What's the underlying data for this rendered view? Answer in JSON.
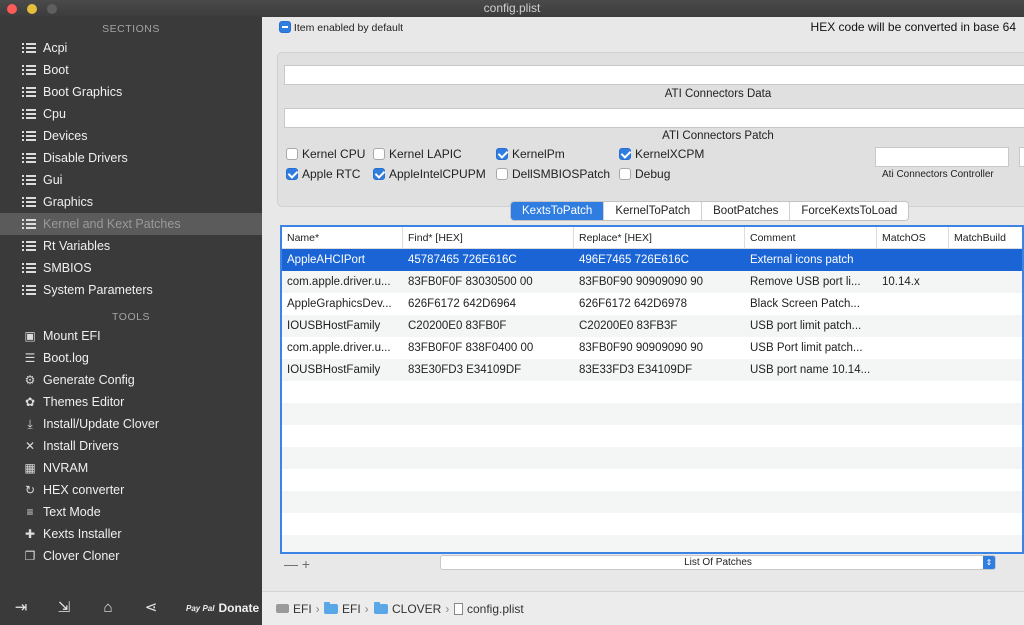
{
  "window": {
    "title": "config.plist"
  },
  "sidebar": {
    "sections_title": "SECTIONS",
    "sections": [
      {
        "label": "Acpi",
        "icon": "list-icon"
      },
      {
        "label": "Boot",
        "icon": "list-icon"
      },
      {
        "label": "Boot Graphics",
        "icon": "list-icon"
      },
      {
        "label": "Cpu",
        "icon": "list-icon"
      },
      {
        "label": "Devices",
        "icon": "list-icon"
      },
      {
        "label": "Disable Drivers",
        "icon": "list-icon"
      },
      {
        "label": "Gui",
        "icon": "list-icon"
      },
      {
        "label": "Graphics",
        "icon": "list-icon"
      },
      {
        "label": "Kernel and Kext Patches",
        "icon": "list-icon",
        "active": true
      },
      {
        "label": "Rt Variables",
        "icon": "list-icon"
      },
      {
        "label": "SMBIOS",
        "icon": "list-icon"
      },
      {
        "label": "System Parameters",
        "icon": "list-icon"
      }
    ],
    "tools_title": "TOOLS",
    "tools": [
      {
        "label": "Mount EFI",
        "icon": "disk-icon"
      },
      {
        "label": "Boot.log",
        "icon": "log-icon"
      },
      {
        "label": "Generate Config",
        "icon": "gears-icon"
      },
      {
        "label": "Themes Editor",
        "icon": "palette-icon"
      },
      {
        "label": "Install/Update Clover",
        "icon": "download-icon"
      },
      {
        "label": "Install Drivers",
        "icon": "tools-icon"
      },
      {
        "label": "NVRAM",
        "icon": "chip-icon"
      },
      {
        "label": "HEX converter",
        "icon": "refresh-icon"
      },
      {
        "label": "Text Mode",
        "icon": "text-icon"
      },
      {
        "label": "Kexts Installer",
        "icon": "puzzle-icon"
      },
      {
        "label": "Clover Cloner",
        "icon": "clone-icon"
      }
    ],
    "bottom": {
      "donate_label": "Donate",
      "paypal_label": "Pay Pal"
    }
  },
  "main": {
    "item_enabled_label": "Item enabled by default",
    "hex_note": "HEX code will be converted in base 64",
    "ati_connectors_data_label": "ATI Connectors Data",
    "ati_connectors_patch_label": "ATI Connectors Patch",
    "ati_connectors_controller_label": "Ati Connectors Controller",
    "options": [
      {
        "label": "Kernel CPU",
        "checked": false
      },
      {
        "label": "Kernel LAPIC",
        "checked": false
      },
      {
        "label": "KernelPm",
        "checked": true
      },
      {
        "label": "KernelXCPM",
        "checked": true
      },
      {
        "label": "Apple RTC",
        "checked": true
      },
      {
        "label": "AppleIntelCPUPM",
        "checked": true
      },
      {
        "label": "DellSMBIOSPatch",
        "checked": false
      },
      {
        "label": "Debug",
        "checked": false
      }
    ],
    "tabs": [
      "KextsToPatch",
      "KernelToPatch",
      "BootPatches",
      "ForceKextsToLoad"
    ],
    "active_tab": "KextsToPatch",
    "table": {
      "columns": [
        "Name*",
        "Find* [HEX]",
        "Replace* [HEX]",
        "Comment",
        "MatchOS",
        "MatchBuild"
      ],
      "rows": [
        {
          "name": "AppleAHCIPort",
          "find": "45787465 726E616C",
          "replace": "496E7465 726E616C",
          "comment": "External icons patch",
          "matchos": "",
          "matchbuild": "",
          "selected": true
        },
        {
          "name": "com.apple.driver.u...",
          "find": "83FB0F0F 83030500 00",
          "replace": "83FB0F90 90909090 90",
          "comment": "Remove USB port li...",
          "matchos": "10.14.x",
          "matchbuild": ""
        },
        {
          "name": "AppleGraphicsDev...",
          "find": "626F6172 642D6964",
          "replace": "626F6172 642D6978",
          "comment": "Black Screen Patch...",
          "matchos": "",
          "matchbuild": ""
        },
        {
          "name": "IOUSBHostFamily",
          "find": "C20200E0 83FB0F",
          "replace": "C20200E0 83FB3F",
          "comment": "USB port limit patch...",
          "matchos": "",
          "matchbuild": ""
        },
        {
          "name": "com.apple.driver.u...",
          "find": "83FB0F0F 838F0400 00",
          "replace": "83FB0F90 90909090 90",
          "comment": "USB Port limit patch...",
          "matchos": "",
          "matchbuild": ""
        },
        {
          "name": "IOUSBHostFamily",
          "find": "83E30FD3 E34109DF",
          "replace": "83E33FD3 E34109DF",
          "comment": "USB port name 10.14...",
          "matchos": "",
          "matchbuild": ""
        }
      ]
    },
    "add_remove": "— +",
    "list_select": "List Of Patches",
    "path": [
      "EFI",
      "EFI",
      "CLOVER",
      "config.plist"
    ]
  },
  "colors": {
    "accent": "#2f7de0",
    "selection": "#1a64d6",
    "sidebar_bg": "#3a3a3a"
  }
}
